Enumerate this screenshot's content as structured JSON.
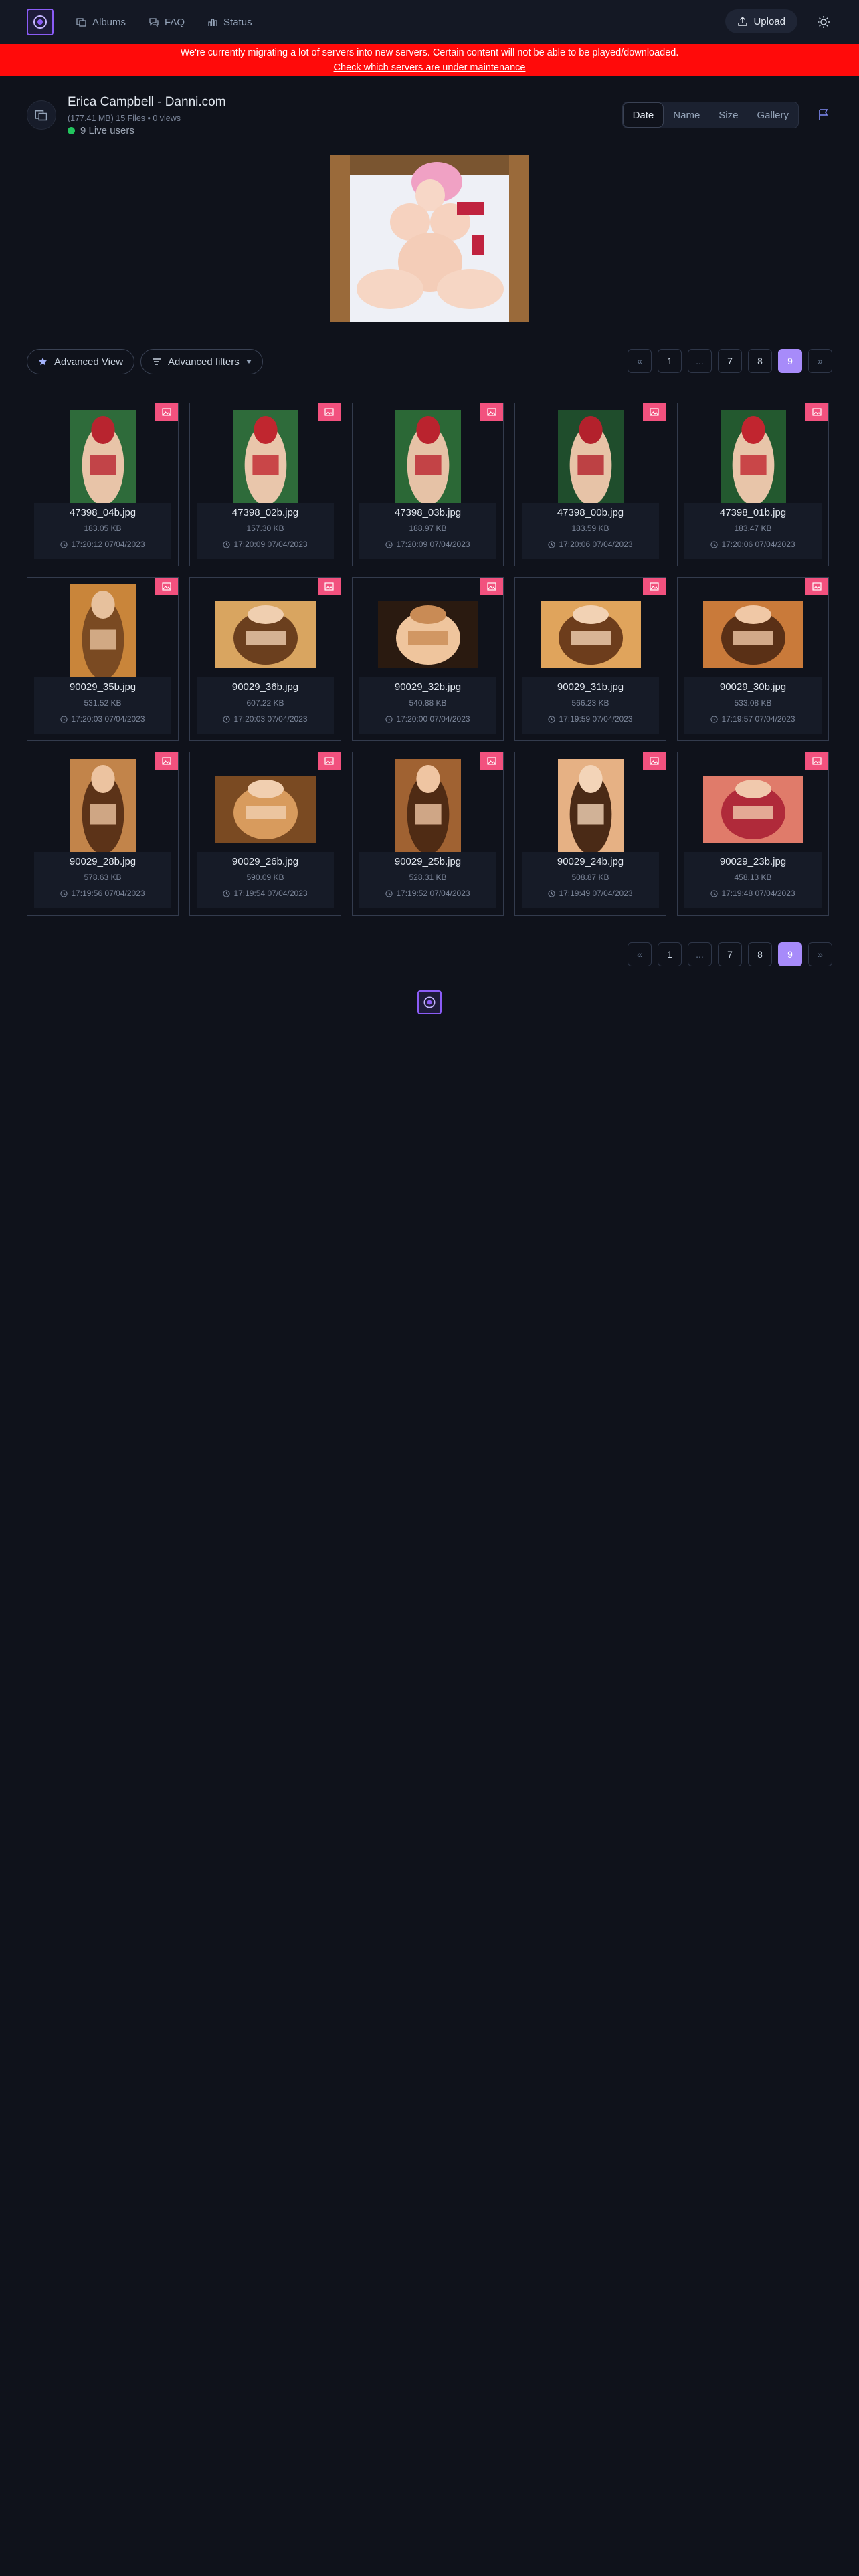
{
  "nav": {
    "links": [
      {
        "label": "Albums",
        "icon": "albums-icon"
      },
      {
        "label": "FAQ",
        "icon": "chat-icon"
      },
      {
        "label": "Status",
        "icon": "status-icon"
      }
    ],
    "upload_label": "Upload"
  },
  "banner": {
    "message": "We're currently migrating a lot of servers into new servers. Certain content will not be able to be played/downloaded.",
    "link_text": "Check which servers are under maintenance"
  },
  "album": {
    "title": "Erica Campbell - Danni.com",
    "meta": "(177.41 MB) 15 Files • 0 views",
    "live": "9 Live users"
  },
  "sort": {
    "options": [
      "Date",
      "Name",
      "Size",
      "Gallery"
    ],
    "active": "Date"
  },
  "toolbar": {
    "advanced_view": "Advanced View",
    "advanced_filters": "Advanced filters"
  },
  "pagination": {
    "prev": "«",
    "pages": [
      "1",
      "...",
      "7",
      "8",
      "9"
    ],
    "current": "9",
    "next": "»"
  },
  "files": [
    {
      "name": "47398_04b.jpg",
      "size": "183.05 KB",
      "date": "17:20:12 07/04/2023"
    },
    {
      "name": "47398_02b.jpg",
      "size": "157.30 KB",
      "date": "17:20:09 07/04/2023"
    },
    {
      "name": "47398_03b.jpg",
      "size": "188.97 KB",
      "date": "17:20:09 07/04/2023"
    },
    {
      "name": "47398_00b.jpg",
      "size": "183.59 KB",
      "date": "17:20:06 07/04/2023"
    },
    {
      "name": "47398_01b.jpg",
      "size": "183.47 KB",
      "date": "17:20:06 07/04/2023"
    },
    {
      "name": "90029_35b.jpg",
      "size": "531.52 KB",
      "date": "17:20:03 07/04/2023"
    },
    {
      "name": "90029_36b.jpg",
      "size": "607.22 KB",
      "date": "17:20:03 07/04/2023"
    },
    {
      "name": "90029_32b.jpg",
      "size": "540.88 KB",
      "date": "17:20:00 07/04/2023"
    },
    {
      "name": "90029_31b.jpg",
      "size": "566.23 KB",
      "date": "17:19:59 07/04/2023"
    },
    {
      "name": "90029_30b.jpg",
      "size": "533.08 KB",
      "date": "17:19:57 07/04/2023"
    },
    {
      "name": "90029_28b.jpg",
      "size": "578.63 KB",
      "date": "17:19:56 07/04/2023"
    },
    {
      "name": "90029_26b.jpg",
      "size": "590.09 KB",
      "date": "17:19:54 07/04/2023"
    },
    {
      "name": "90029_25b.jpg",
      "size": "528.31 KB",
      "date": "17:19:52 07/04/2023"
    },
    {
      "name": "90029_24b.jpg",
      "size": "508.87 KB",
      "date": "17:19:49 07/04/2023"
    },
    {
      "name": "90029_23b.jpg",
      "size": "458.13 KB",
      "date": "17:19:48 07/04/2023"
    }
  ],
  "colors": {
    "accent": "#8b5cf6",
    "banner": "#ff0a0a",
    "badge": "#f2517e",
    "live": "#22c55e",
    "active_page": "#a78bfa"
  }
}
